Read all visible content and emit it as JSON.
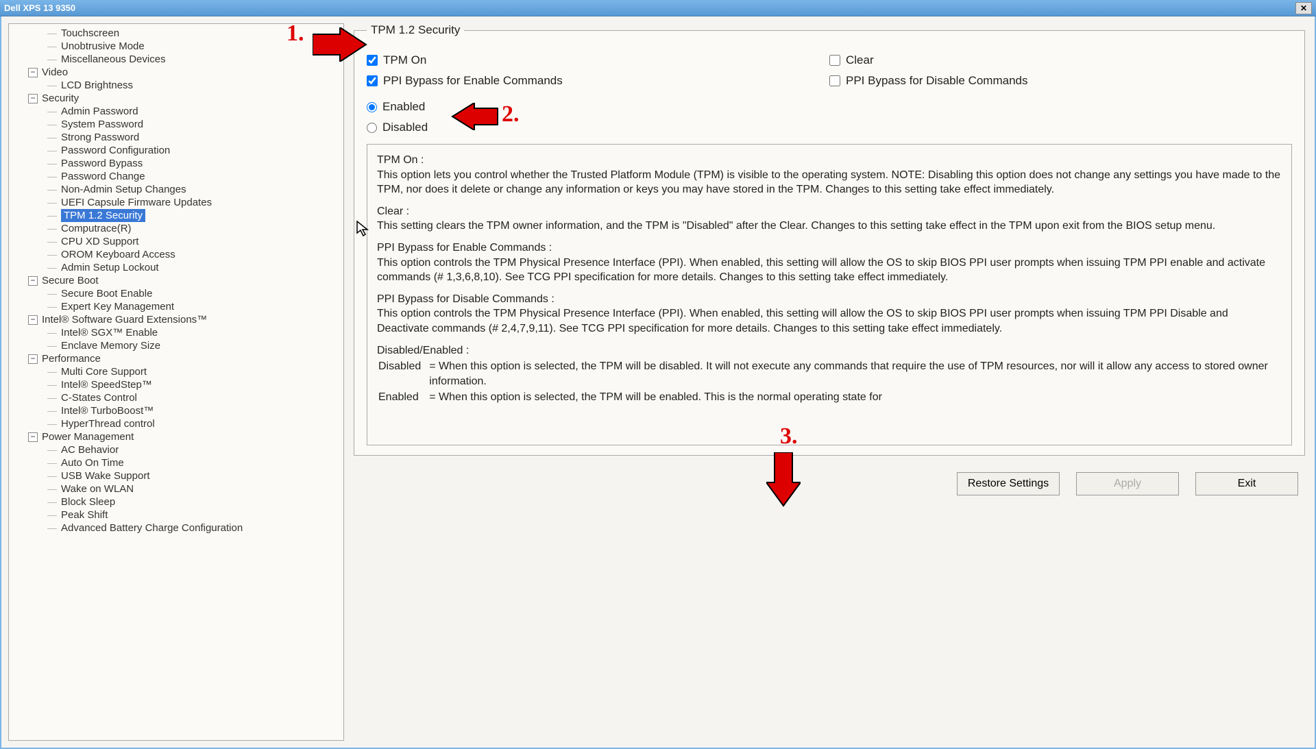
{
  "window": {
    "title": "Dell XPS 13 9350"
  },
  "sidebar": {
    "items": [
      {
        "type": "item",
        "label": "Touchscreen"
      },
      {
        "type": "item",
        "label": "Unobtrusive Mode"
      },
      {
        "type": "item",
        "label": "Miscellaneous Devices"
      },
      {
        "type": "cat",
        "label": "Video"
      },
      {
        "type": "item",
        "label": "LCD Brightness"
      },
      {
        "type": "cat",
        "label": "Security"
      },
      {
        "type": "item",
        "label": "Admin Password"
      },
      {
        "type": "item",
        "label": "System Password"
      },
      {
        "type": "item",
        "label": "Strong Password"
      },
      {
        "type": "item",
        "label": "Password Configuration"
      },
      {
        "type": "item",
        "label": "Password Bypass"
      },
      {
        "type": "item",
        "label": "Password Change"
      },
      {
        "type": "item",
        "label": "Non-Admin Setup Changes"
      },
      {
        "type": "item",
        "label": "UEFI Capsule Firmware Updates"
      },
      {
        "type": "item",
        "label": "TPM 1.2 Security",
        "selected": true
      },
      {
        "type": "item",
        "label": "Computrace(R)"
      },
      {
        "type": "item",
        "label": "CPU XD Support"
      },
      {
        "type": "item",
        "label": "OROM Keyboard Access"
      },
      {
        "type": "item",
        "label": "Admin Setup Lockout"
      },
      {
        "type": "cat",
        "label": "Secure Boot"
      },
      {
        "type": "item",
        "label": "Secure Boot Enable"
      },
      {
        "type": "item",
        "label": "Expert Key Management"
      },
      {
        "type": "cat",
        "label": "Intel® Software Guard Extensions™"
      },
      {
        "type": "item",
        "label": "Intel® SGX™ Enable"
      },
      {
        "type": "item",
        "label": "Enclave Memory Size"
      },
      {
        "type": "cat",
        "label": "Performance"
      },
      {
        "type": "item",
        "label": "Multi Core Support"
      },
      {
        "type": "item",
        "label": "Intel® SpeedStep™"
      },
      {
        "type": "item",
        "label": "C-States Control"
      },
      {
        "type": "item",
        "label": "Intel® TurboBoost™"
      },
      {
        "type": "item",
        "label": "HyperThread control"
      },
      {
        "type": "cat",
        "label": "Power Management"
      },
      {
        "type": "item",
        "label": "AC Behavior"
      },
      {
        "type": "item",
        "label": "Auto On Time"
      },
      {
        "type": "item",
        "label": "USB Wake Support"
      },
      {
        "type": "item",
        "label": "Wake on WLAN"
      },
      {
        "type": "item",
        "label": "Block Sleep"
      },
      {
        "type": "item",
        "label": "Peak Shift"
      },
      {
        "type": "item",
        "label": "Advanced Battery Charge Configuration"
      }
    ]
  },
  "panel": {
    "legend": "TPM 1.2 Security",
    "checks": [
      {
        "label": "TPM On",
        "checked": true
      },
      {
        "label": "Clear",
        "checked": false
      },
      {
        "label": "PPI Bypass for Enable Commands",
        "checked": true
      },
      {
        "label": "PPI Bypass for Disable Commands",
        "checked": false
      }
    ],
    "radios": [
      {
        "label": "Enabled",
        "checked": true
      },
      {
        "label": "Disabled",
        "checked": false
      }
    ],
    "help": {
      "tpm_on_h": "TPM On :",
      "tpm_on": "This option lets you control whether the Trusted Platform Module (TPM) is visible to the operating system. NOTE: Disabling this option does not change any settings you have made to the TPM, nor does it delete or change any information or keys you may have stored in the TPM.  Changes to this setting take effect immediately.",
      "clear_h": "Clear :",
      "clear": "This setting clears the TPM owner information, and the TPM is \"Disabled\" after the Clear.  Changes to this setting take effect in the TPM upon exit from the BIOS setup menu.",
      "ppien_h": "PPI Bypass for Enable Commands :",
      "ppien": "This option controls the TPM Physical Presence Interface (PPI). When enabled, this setting will allow the OS to skip BIOS PPI user prompts when issuing TPM PPI enable and activate commands (# 1,3,6,8,10).  See TCG PPI specification for more details. Changes to this setting take effect immediately.",
      "ppidis_h": "PPI Bypass for Disable Commands :",
      "ppidis": "This option controls the TPM Physical Presence Interface (PPI). When enabled, this setting will allow the OS to skip BIOS PPI user prompts when issuing TPM PPI Disable and Deactivate commands (# 2,4,7,9,11).  See TCG PPI specification for more details.  Changes to this setting take effect immediately.",
      "de_h": "Disabled/Enabled :",
      "dis_k": "Disabled",
      "dis_v": "= When this option is selected, the TPM will be disabled. It will not execute any commands that require the use of TPM resources, nor will it allow any access to stored owner information.",
      "en_k": "Enabled",
      "en_v": "= When this option is selected, the TPM will be enabled. This is the normal operating state for"
    }
  },
  "footer": {
    "restore": "Restore Settings",
    "apply": "Apply",
    "exit": "Exit"
  },
  "annotations": {
    "n1": "1.",
    "n2": "2.",
    "n3": "3."
  }
}
